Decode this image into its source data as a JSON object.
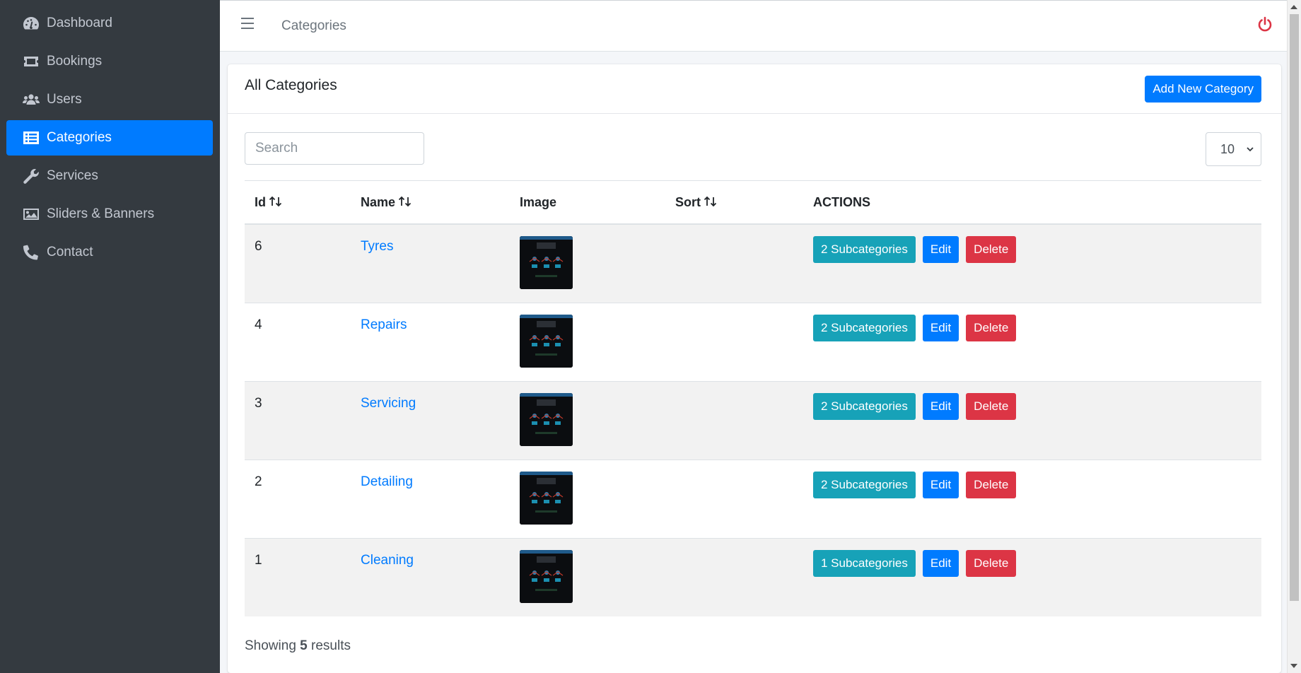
{
  "sidebar": {
    "items": [
      {
        "label": "Dashboard",
        "icon": "tachometer-icon",
        "active": false
      },
      {
        "label": "Bookings",
        "icon": "ticket-icon",
        "active": false
      },
      {
        "label": "Users",
        "icon": "users-icon",
        "active": false
      },
      {
        "label": "Categories",
        "icon": "list-icon",
        "active": true
      },
      {
        "label": "Services",
        "icon": "wrench-icon",
        "active": false
      },
      {
        "label": "Sliders & Banners",
        "icon": "image-icon",
        "active": false
      },
      {
        "label": "Contact",
        "icon": "phone-icon",
        "active": false
      }
    ]
  },
  "topbar": {
    "page_title": "Categories",
    "menu_icon": "hamburger-icon",
    "logout_icon": "power-icon"
  },
  "card": {
    "title": "All Categories",
    "add_button": "Add New Category",
    "search_placeholder": "Search",
    "per_page": "10"
  },
  "table": {
    "headers": {
      "id": "Id",
      "name": "Name",
      "image": "Image",
      "sort": "Sort",
      "actions": "ACTIONS"
    },
    "rows": [
      {
        "id": "6",
        "name": "Tyres",
        "sort": "",
        "subcategories": "2 Subcategories",
        "edit": "Edit",
        "delete": "Delete"
      },
      {
        "id": "4",
        "name": "Repairs",
        "sort": "",
        "subcategories": "2 Subcategories",
        "edit": "Edit",
        "delete": "Delete"
      },
      {
        "id": "3",
        "name": "Servicing",
        "sort": "",
        "subcategories": "2 Subcategories",
        "edit": "Edit",
        "delete": "Delete"
      },
      {
        "id": "2",
        "name": "Detailing",
        "sort": "",
        "subcategories": "2 Subcategories",
        "edit": "Edit",
        "delete": "Delete"
      },
      {
        "id": "1",
        "name": "Cleaning",
        "sort": "",
        "subcategories": "1 Subcategories",
        "edit": "Edit",
        "delete": "Delete"
      }
    ]
  },
  "footer": {
    "prefix": "Showing",
    "count": "5",
    "suffix": "results"
  },
  "colors": {
    "sidebar_bg": "#343a40",
    "accent": "#007bff",
    "info": "#17a2b8",
    "danger": "#dc3545"
  }
}
